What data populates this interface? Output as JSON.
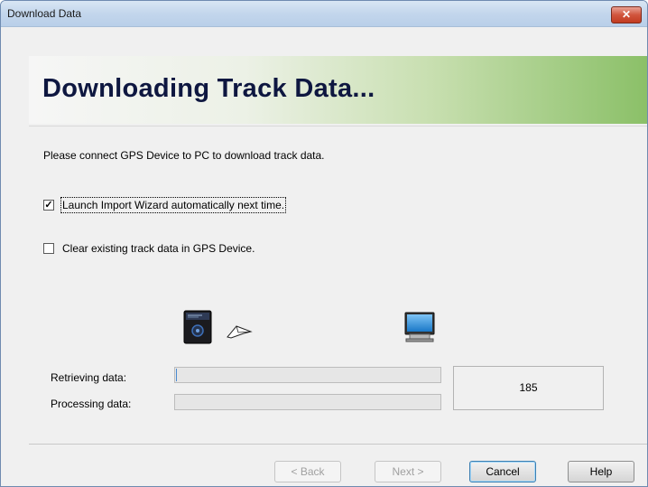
{
  "window": {
    "title": "Download Data",
    "close_glyph": "✕"
  },
  "banner": {
    "title": "Downloading Track Data..."
  },
  "instruction": "Please connect GPS Device to PC to download track data.",
  "options": [
    {
      "label": "Launch Import Wizard automatically next time.",
      "checked": true
    },
    {
      "label": "Clear existing track data in GPS Device.",
      "checked": false
    }
  ],
  "transfer": {
    "source_icon": "gps-device-icon",
    "arrow_icon": "transfer-arrow-icon",
    "target_icon": "computer-monitor-icon",
    "retrieving_label": "Retrieving data:",
    "processing_label": "Processing data:",
    "retrieving_progress": 0.0,
    "processing_progress": 0.0,
    "count": "185"
  },
  "buttons": {
    "back": "< Back",
    "next": "Next >",
    "cancel": "Cancel",
    "help": "Help"
  },
  "colors": {
    "banner_green": "#8bc068",
    "banner_title": "#0e1740",
    "close_red": "#c23b21"
  }
}
